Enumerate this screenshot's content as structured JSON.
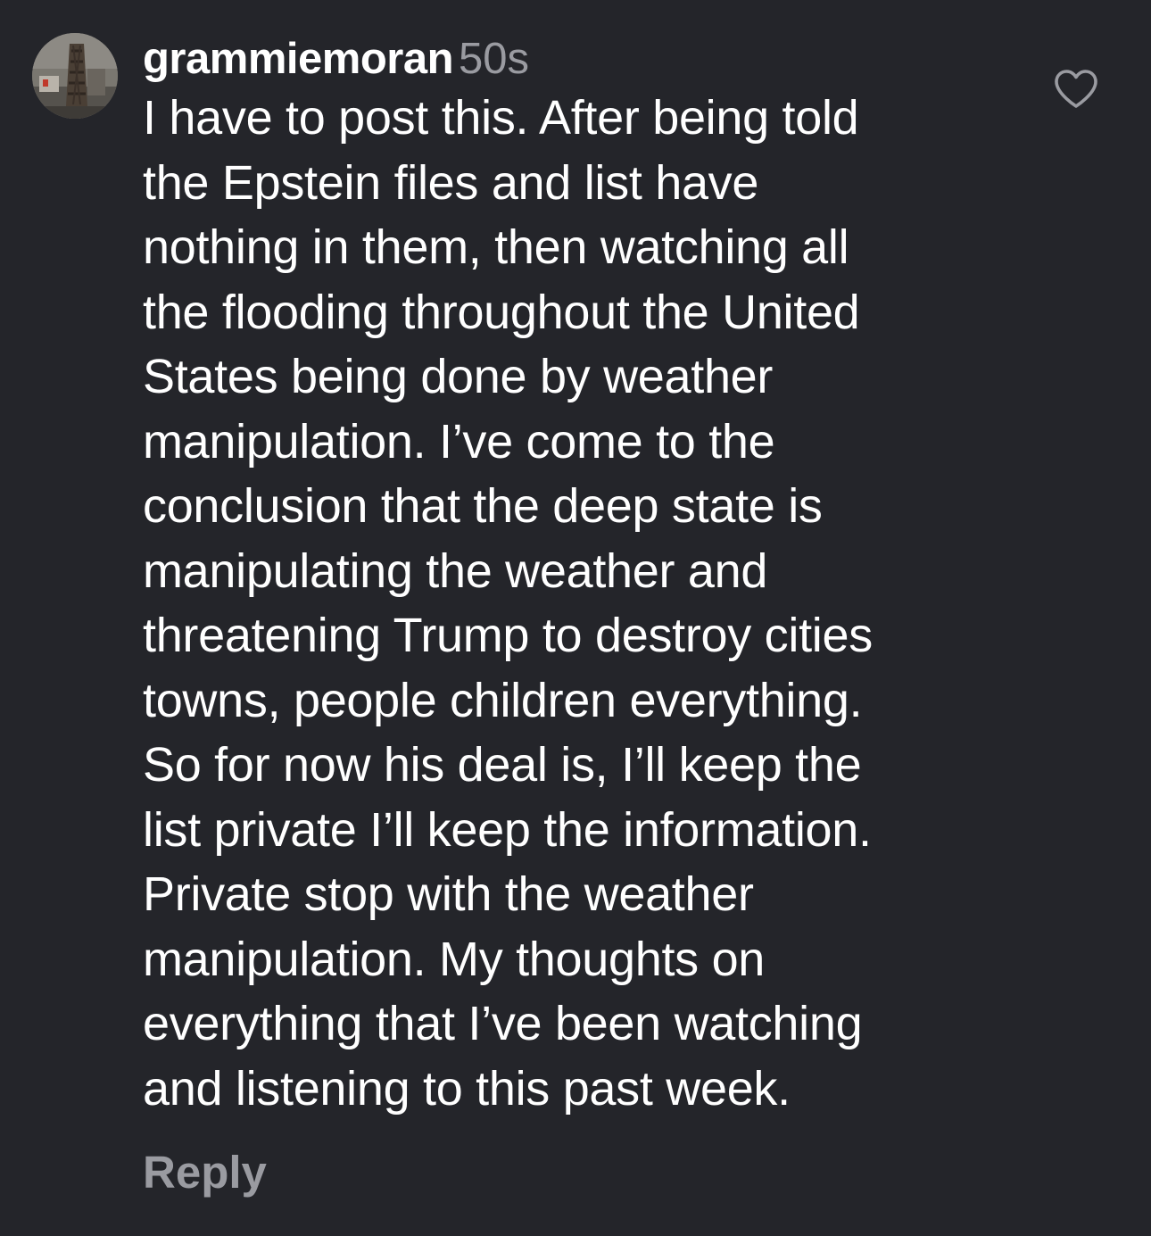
{
  "comment": {
    "username": "grammiemoran",
    "timestamp": "50s",
    "text_lines": [
      "I have to post this. After being told",
      "the Epstein files and list have",
      "nothing in them, then watching all",
      "the flooding throughout the United",
      "States being done by weather",
      "manipulation. I’ve come to the",
      "conclusion that the deep state is",
      "manipulating the weather and",
      "threatening Trump to destroy cities",
      "towns, people children everything.",
      "So for now his deal is, I’ll keep the",
      "list private I’ll keep the information.",
      "Private stop with the weather",
      "manipulation. My thoughts on",
      "everything that I’ve been watching",
      "and listening to this past week."
    ],
    "reply_label": "Reply",
    "like_icon": "heart-outline-icon",
    "avatar_icon": "profile-photo"
  },
  "colors": {
    "background": "#24252a",
    "text": "#ffffff",
    "muted": "#9a9ba1"
  }
}
